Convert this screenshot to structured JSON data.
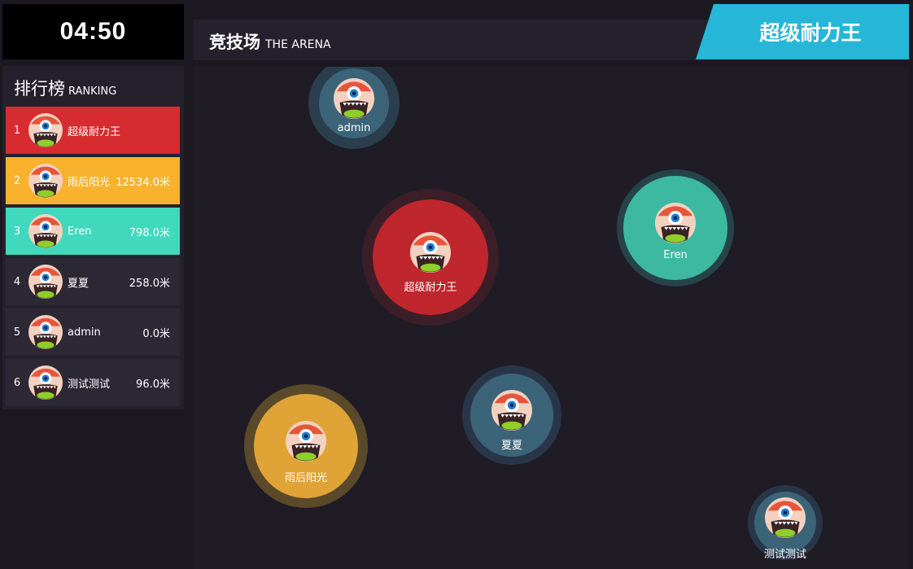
{
  "timer": "04:50",
  "arena_header": {
    "title": "竞技场",
    "subtitle": "THE ARENA"
  },
  "leader": "超级耐力王",
  "ranking": {
    "title": "排行榜",
    "subtitle": "RANKING",
    "rows": [
      {
        "rank": "1",
        "name": "超级耐力王",
        "score": "",
        "color": "#d62b2f"
      },
      {
        "rank": "2",
        "name": "雨后阳光",
        "score": "12534.0米",
        "color": "#f8b22e"
      },
      {
        "rank": "3",
        "name": "Eren",
        "score": "798.0米",
        "color": "#40d9bd"
      },
      {
        "rank": "4",
        "name": "夏夏",
        "score": "258.0米",
        "color": "#2c2935"
      },
      {
        "rank": "5",
        "name": "admin",
        "score": "0.0米",
        "color": "#2c2935"
      },
      {
        "rank": "6",
        "name": "测试测试",
        "score": "96.0米",
        "color": "#2c2935"
      }
    ]
  },
  "players": [
    {
      "name": "admin",
      "color": "#3c6478",
      "halo": "#2b3e4d"
    },
    {
      "name": "超级耐力王",
      "color": "#bf262d",
      "halo": "#3c1e28"
    },
    {
      "name": "Eren",
      "color": "#3db9a1",
      "halo": "#27434a"
    },
    {
      "name": "雨后阳光",
      "color": "#e0a335",
      "halo": "#5a4a2a"
    },
    {
      "name": "夏夏",
      "color": "#3c6478",
      "halo": "#29364a"
    },
    {
      "name": "测试测试",
      "color": "#3c6478",
      "halo": "#29364a"
    }
  ],
  "icons": {
    "avatar": "one-eyed-monster-icon"
  }
}
